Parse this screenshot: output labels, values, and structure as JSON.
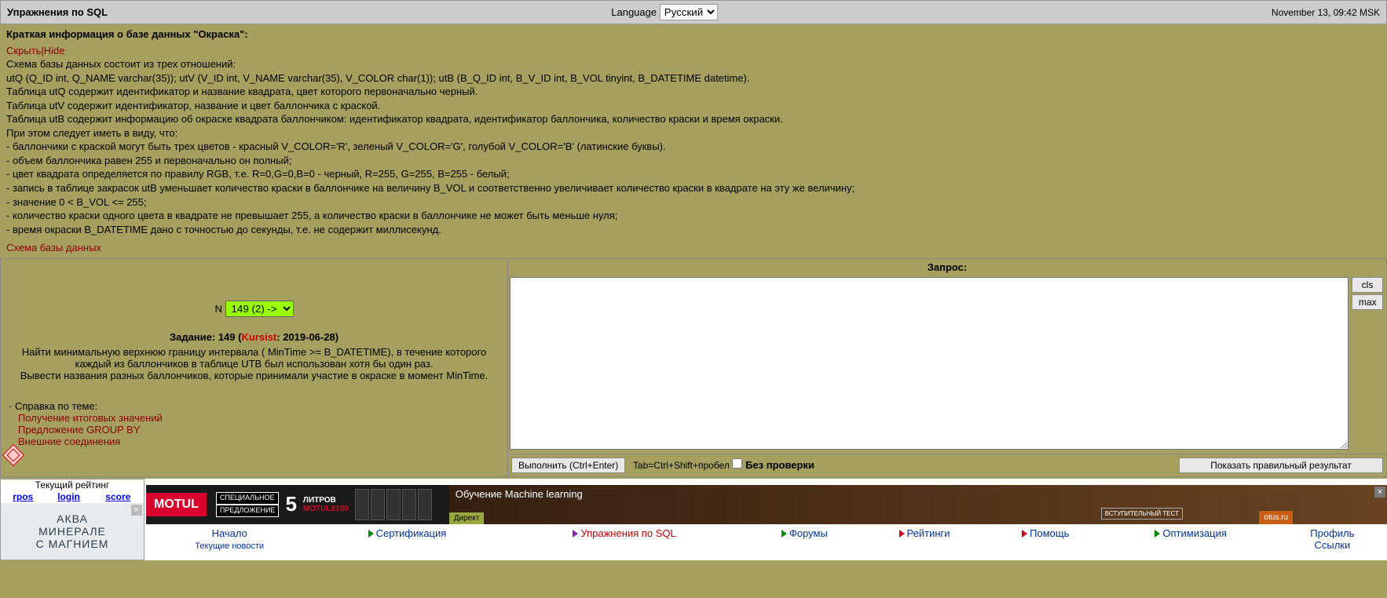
{
  "header": {
    "title": "Упражнения по SQL",
    "language_label": "Language",
    "language_value": "Русский",
    "datetime": "November 13, 09:42 MSK"
  },
  "info": {
    "heading": "Краткая информация о базе данных \"Окраска\":",
    "hide_link": "Скрыть|Hide",
    "lines": [
      "Схема базы данных состоит из трех отношений:",
      "utQ (Q_ID int, Q_NAME varchar(35)); utV (V_ID int, V_NAME varchar(35), V_COLOR char(1)); utB (B_Q_ID int, B_V_ID int, B_VOL tinyint, B_DATETIME datetime).",
      "Таблица utQ содержит идентификатор и название квадрата, цвет которого первоначально черный.",
      "Таблица utV содержит идентификатор, название и цвет баллончика с краской.",
      "Таблица utB содержит информацию об окраске квадрата баллончиком: идентификатор квадрата, идентификатор баллончика, количество краски и время окраски.",
      "При этом следует иметь в виду, что:",
      "- баллончики с краской могут быть трех цветов - красный V_COLOR='R', зеленый V_COLOR='G', голубой V_COLOR='B' (латинские буквы).",
      "- объем баллончика равен 255 и первоначально он полный;",
      "- цвет квадрата определяется по правилу RGB, т.е. R=0,G=0,B=0 - черный, R=255, G=255, B=255 - белый;",
      "- запись в таблице закрасок utB уменьшает количество краски в баллончике на величину B_VOL и соответственно увеличивает количество краски в квадрате на эту же величину;",
      "- значение 0 < B_VOL <= 255;",
      "- количество краски одного цвета в квадрате не превышает 255, а количество краски в баллончике не может быть меньше нуля;",
      "- время окраски B_DATETIME дано с точностью до секунды, т.е. не содержит миллисекунд."
    ],
    "schema_link": "Схема базы данных"
  },
  "task": {
    "n_label": "N",
    "problem_selector": "149 (2) ->",
    "task_prefix": "Задание: 149 (",
    "author": "Kursist",
    "task_suffix": ": 2019-06-28)",
    "text1": "Найти минимальную верхнюю границу интервала ( MinTime >= B_DATETIME), в течение которого каждый из баллончиков в таблице UTB был использован хотя бы один раз.",
    "text2": "Вывести названия разных баллончиков, которые принимали участие в окраске в момент MinTime.",
    "ref_title": "Справка по теме:",
    "refs": [
      "Получение итоговых значений",
      "Предложение GROUP BY",
      "Внешние соединения"
    ]
  },
  "query": {
    "label": "Запрос:",
    "cls": "cls",
    "max": "max",
    "execute": "Выполнить (Ctrl+Enter)",
    "shortcut": "Tab=Ctrl+Shift+пробел",
    "nocheck": "Без  проверки",
    "show_correct": "Показать правильный результат"
  },
  "bottom": {
    "rating_title": "Текущий рейтинг",
    "rating_cols": [
      "rpos",
      "login",
      "score"
    ],
    "aqua_l1": "АКВА",
    "aqua_l2": "МИНЕРАЛЕ",
    "aqua_l3": "С МАГНИЕМ",
    "motul_brand": "MOTUL",
    "motul_sp1": "СПЕЦИАЛЬНОЕ",
    "motul_sp2": "ПРЕДЛОЖЕНИЕ",
    "motul_num": "5",
    "motul_litr": "ЛИТРОВ",
    "motul_prod": "MOTUL8100",
    "otus_title": "Обучение Machine learning",
    "otus_tag": "Директ",
    "otus_test": "ВСТУПИТЕЛЬНЫЙ ТЕСТ",
    "otus_site": "otus.ru"
  },
  "nav": {
    "home": "Начало",
    "home_sub": "Текущие новости",
    "cert": "Сертификация",
    "sql": "Упражнения по SQL",
    "forums": "Форумы",
    "ratings": "Рейтинги",
    "help": "Помощь",
    "opt": "Оптимизация",
    "profile": "Профиль",
    "links": "Ссылки"
  }
}
